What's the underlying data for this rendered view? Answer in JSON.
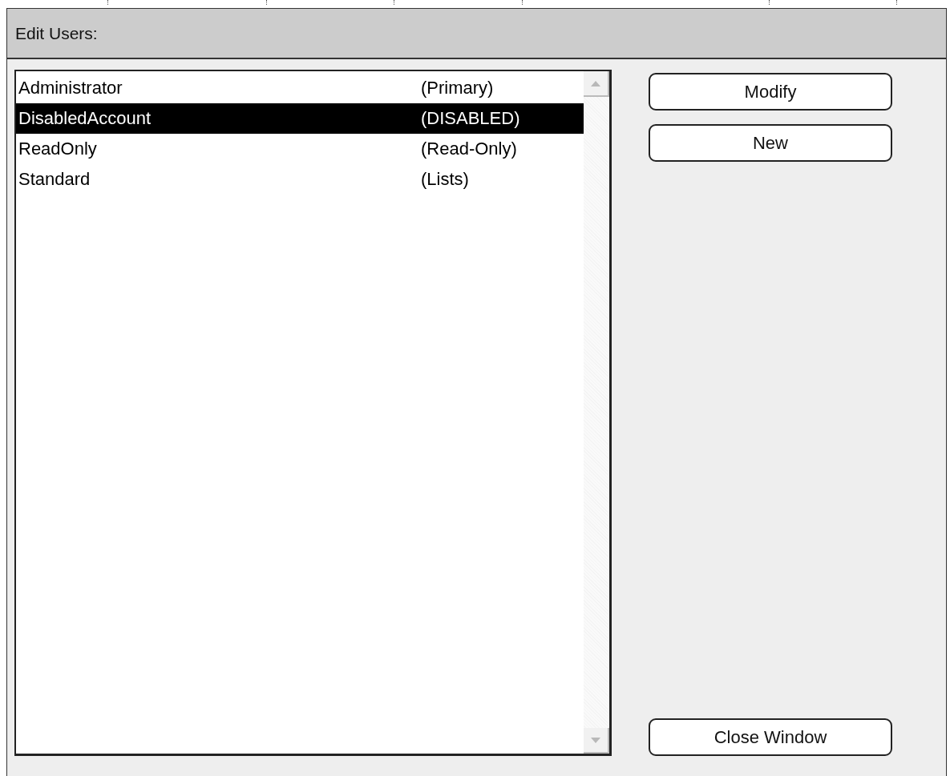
{
  "panel": {
    "title": "Edit Users:"
  },
  "users": [
    {
      "name": "Administrator",
      "role": "(Primary)",
      "selected": false
    },
    {
      "name": "DisabledAccount",
      "role": "(DISABLED)",
      "selected": true
    },
    {
      "name": "ReadOnly",
      "role": "(Read-Only)",
      "selected": false
    },
    {
      "name": "Standard",
      "role": "(Lists)",
      "selected": false
    }
  ],
  "buttons": [
    {
      "label": "Modify",
      "kind": "top"
    },
    {
      "label": "New",
      "kind": "top"
    },
    {
      "label": "Close Window",
      "kind": "bottom"
    }
  ]
}
